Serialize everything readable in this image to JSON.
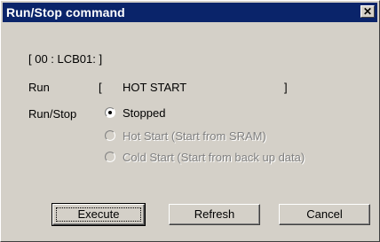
{
  "window": {
    "title": "Run/Stop command",
    "close_glyph": "✕"
  },
  "station_label": "[ 00 : LCB01: ]",
  "run": {
    "label": "Run",
    "open_bracket": "[",
    "value": "HOT START",
    "close_bracket": "]"
  },
  "run_stop": {
    "label": "Run/Stop",
    "options": [
      {
        "label": "Stopped",
        "selected": true,
        "enabled": true
      },
      {
        "label": "Hot Start (Start from SRAM)",
        "selected": false,
        "enabled": false
      },
      {
        "label": "Cold Start (Start from back up data)",
        "selected": false,
        "enabled": false
      }
    ]
  },
  "buttons": {
    "execute": "Execute",
    "refresh": "Refresh",
    "cancel": "Cancel"
  }
}
